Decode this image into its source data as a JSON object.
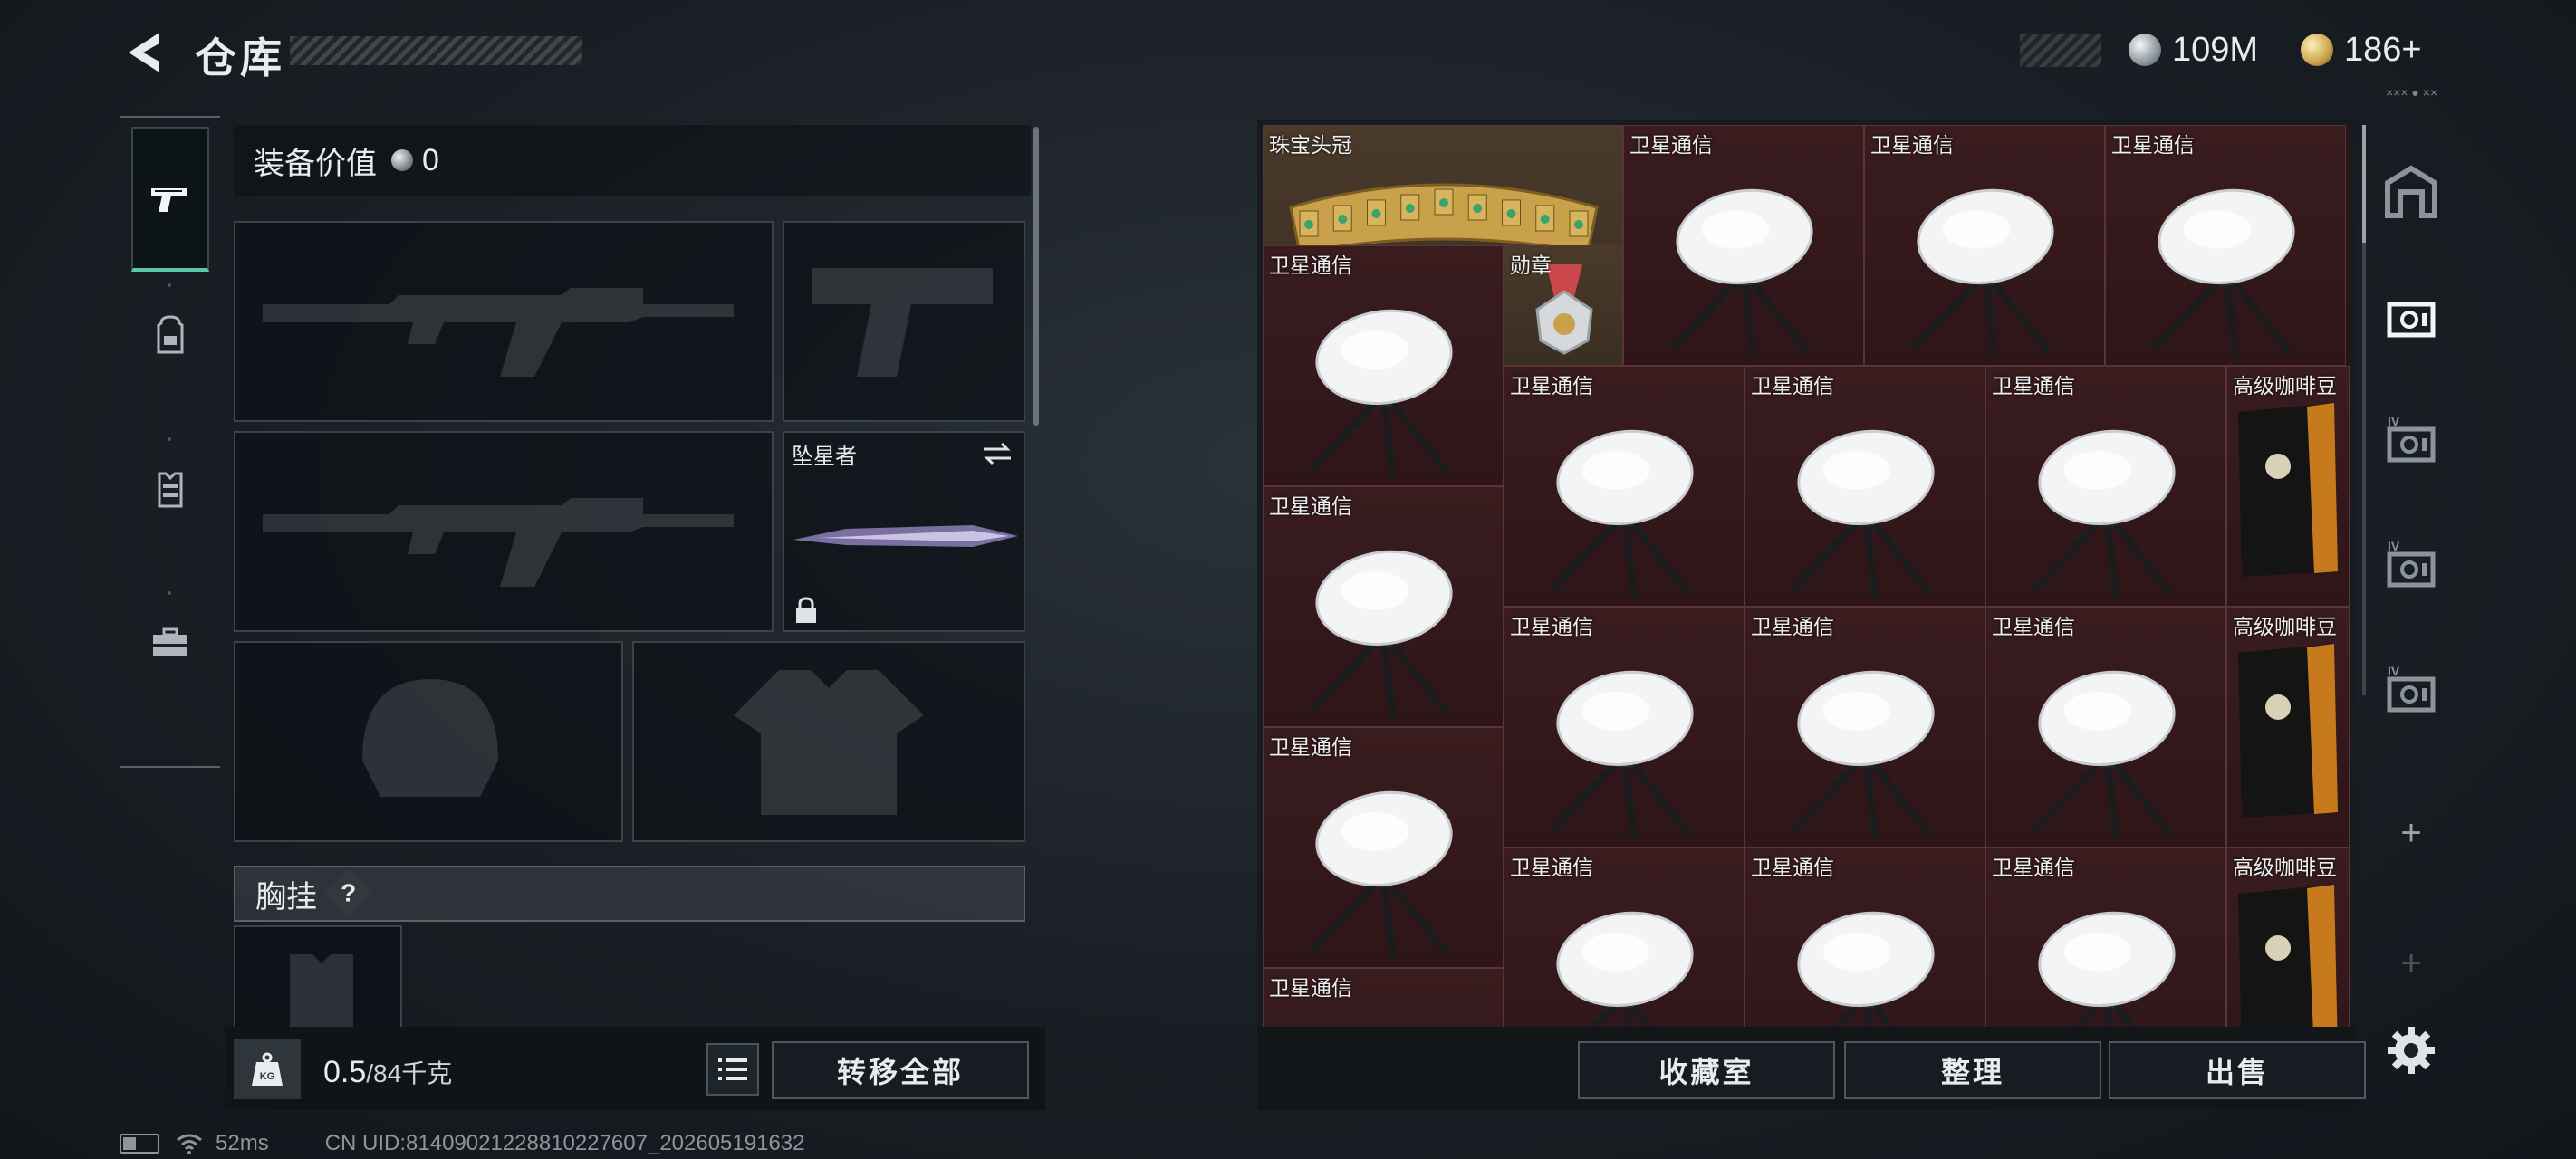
{
  "header": {
    "title": "仓库",
    "silver_amount": "109M",
    "gold_amount": "186+",
    "hud_small": "××× ● ××"
  },
  "left_tabs": [
    {
      "name": "weapon",
      "icon": "pistol-icon",
      "active": true
    },
    {
      "name": "backpack",
      "icon": "backpack-icon",
      "active": false
    },
    {
      "name": "armor",
      "icon": "vest-icon",
      "active": false
    },
    {
      "name": "kit",
      "icon": "toolbox-icon",
      "active": false
    }
  ],
  "equipment": {
    "value_label": "装备价值",
    "value": "0",
    "melee_name": "坠星者",
    "chest_label": "胸挂",
    "chest_help": "?"
  },
  "bottom_left": {
    "weight": "0.5",
    "weight_cap": "/84千克",
    "weight_icon_text": "KG",
    "transfer_all": "转移全部"
  },
  "status": {
    "ping": "52ms",
    "uid": "CN UID:81409021228810227607_202605191632"
  },
  "storage": {
    "items": [
      {
        "name": "珠宝头冠",
        "type": "crown"
      },
      {
        "name": "卫星通信",
        "type": "dish"
      },
      {
        "name": "卫星通信",
        "type": "dish"
      },
      {
        "name": "卫星通信",
        "type": "dish"
      },
      {
        "name": "卫星通信",
        "type": "dish"
      },
      {
        "name": "勋章",
        "type": "medal"
      },
      {
        "name": "卫星通信",
        "type": "dish"
      },
      {
        "name": "卫星通信",
        "type": "dish"
      },
      {
        "name": "卫星通信",
        "type": "dish"
      },
      {
        "name": "高级咖啡豆",
        "type": "coffee"
      },
      {
        "name": "卫星通信",
        "type": "dish"
      },
      {
        "name": "卫星通信",
        "type": "dish"
      },
      {
        "name": "卫星通信",
        "type": "dish"
      },
      {
        "name": "卫星通信",
        "type": "dish"
      },
      {
        "name": "高级咖啡豆",
        "type": "coffee"
      },
      {
        "name": "卫星通信",
        "type": "dish"
      },
      {
        "name": "卫星通信",
        "type": "dish"
      },
      {
        "name": "卫星通信",
        "type": "dish"
      },
      {
        "name": "卫星通信",
        "type": "dish"
      },
      {
        "name": "高级咖啡豆",
        "type": "coffee"
      },
      {
        "name": "卫星通信",
        "type": "dish"
      }
    ],
    "buttons": {
      "collection": "收藏室",
      "sort": "整理",
      "sell": "出售"
    }
  },
  "right_rail": {
    "tabs": [
      {
        "icon": "safe-house-icon",
        "label": ""
      },
      {
        "icon": "storage-case-icon",
        "label": ""
      },
      {
        "icon": "storage-case-iv-icon",
        "label": "IV"
      },
      {
        "icon": "storage-case-iv-icon",
        "label": "IV"
      },
      {
        "icon": "storage-case-iv-icon",
        "label": "IV"
      }
    ],
    "add": "+"
  },
  "colors": {
    "accent": "#5cc7a7",
    "cell_bg": "#3a1c1f",
    "cell_border": "#5a3438"
  }
}
